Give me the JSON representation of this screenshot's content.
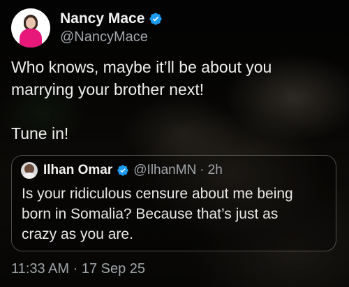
{
  "author": {
    "name": "Nancy Mace",
    "handle": "@NancyMace"
  },
  "tweet": {
    "line1": "Who knows, maybe it’ll be about you",
    "line2": "marrying your brother next!",
    "line3": "Tune in!"
  },
  "quoted": {
    "name": "Ilhan Omar",
    "handle": "@IlhanMN",
    "separator": "·",
    "age": "2h",
    "line1": "Is your ridiculous censure about me being",
    "line2": "born in Somalia? Because that’s just as",
    "line3": "crazy as you are."
  },
  "meta": {
    "time": "11:33 AM",
    "separator": "·",
    "date": "17 Sep 25"
  },
  "colors": {
    "verified": "#1d9bf0",
    "secondary_text": "#a0a6ab",
    "avatar_top": "#e8177a"
  },
  "icons": {
    "verified": "verified-badge-icon"
  }
}
